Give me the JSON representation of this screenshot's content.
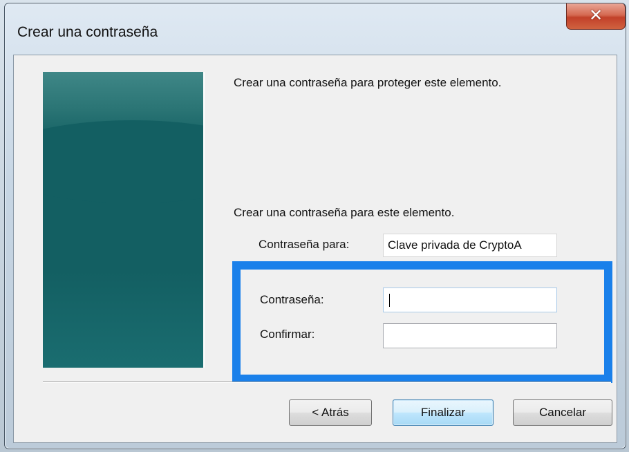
{
  "window": {
    "title": "Crear una contraseña",
    "close_glyph": "✕"
  },
  "wizard": {
    "heading": "Crear una contraseña para proteger este elemento.",
    "subheading": "Crear una contraseña para este elemento.",
    "password_for": {
      "label": "Contraseña para:",
      "value": "Clave privada de CryptoA"
    },
    "password": {
      "label": "Contraseña:",
      "value": ""
    },
    "confirm": {
      "label": "Confirmar:",
      "value": ""
    }
  },
  "buttons": {
    "back": "< Atrás",
    "finish": "Finalizar",
    "cancel": "Cancelar"
  },
  "colors": {
    "highlight_border": "#1a80ea",
    "side_panel": "#135f62",
    "close_button": "#c2412a"
  }
}
